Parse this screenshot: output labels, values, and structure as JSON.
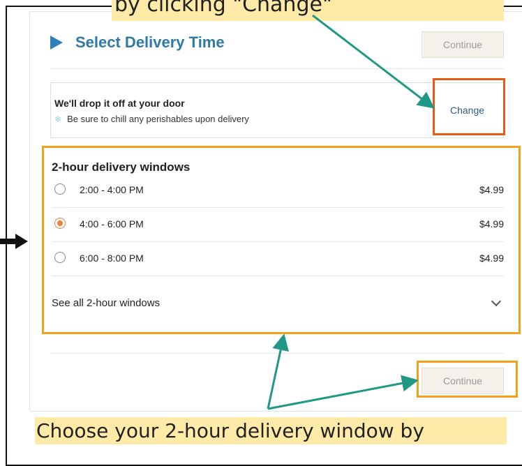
{
  "callouts": {
    "top": "by clicking \"Change\"",
    "bottom": "Choose your 2-hour delivery window by"
  },
  "header": {
    "title": "Select Delivery Time",
    "continue_label": "Continue"
  },
  "delivery_info": {
    "title": "We'll drop it off at your door",
    "note": "Be sure to chill any perishables upon delivery",
    "change_label": "Change",
    "note_icon": "snowflake-icon"
  },
  "windows": {
    "title": "2-hour delivery windows",
    "slots": [
      {
        "time": "2:00 - 4:00 PM",
        "price": "$4.99",
        "selected": false
      },
      {
        "time": "4:00 - 6:00 PM",
        "price": "$4.99",
        "selected": true
      },
      {
        "time": "6:00 - 8:00 PM",
        "price": "$4.99",
        "selected": false
      }
    ],
    "see_all_label": "See all 2-hour windows"
  },
  "footer": {
    "continue_label": "Continue"
  },
  "colors": {
    "title_blue": "#2f79a6",
    "highlight_orange": "#f5a01b",
    "change_box_orange": "#e45c13",
    "arrow_teal": "#1f9886",
    "callout_yellow": "#ffeaa8"
  }
}
